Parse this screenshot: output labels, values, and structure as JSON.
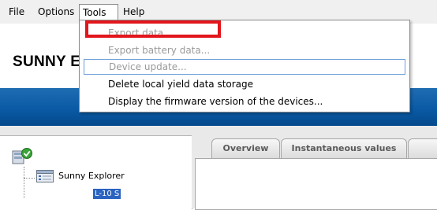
{
  "menu": {
    "file": "File",
    "options": "Options",
    "tools": "Tools",
    "help": "Help"
  },
  "tools_menu": {
    "items": [
      {
        "label": "Export data...",
        "enabled": false
      },
      {
        "label": "Export battery data...",
        "enabled": false
      },
      {
        "label": "Device update...",
        "enabled": false
      },
      {
        "label": "Delete local yield data storage",
        "enabled": true
      },
      {
        "label": "Display the firmware version of the devices...",
        "enabled": true
      }
    ]
  },
  "header": {
    "title": "SUNNY E"
  },
  "tree": {
    "root_label": "Sunny Explorer",
    "selected_label": "L-10 S"
  },
  "tabs": {
    "overview": "Overview",
    "instantaneous": "Instantaneous values"
  },
  "colors": {
    "accent_blue": "#0a5aa5",
    "highlight_red": "#e2161c",
    "selection_blue": "#2a63c0"
  }
}
